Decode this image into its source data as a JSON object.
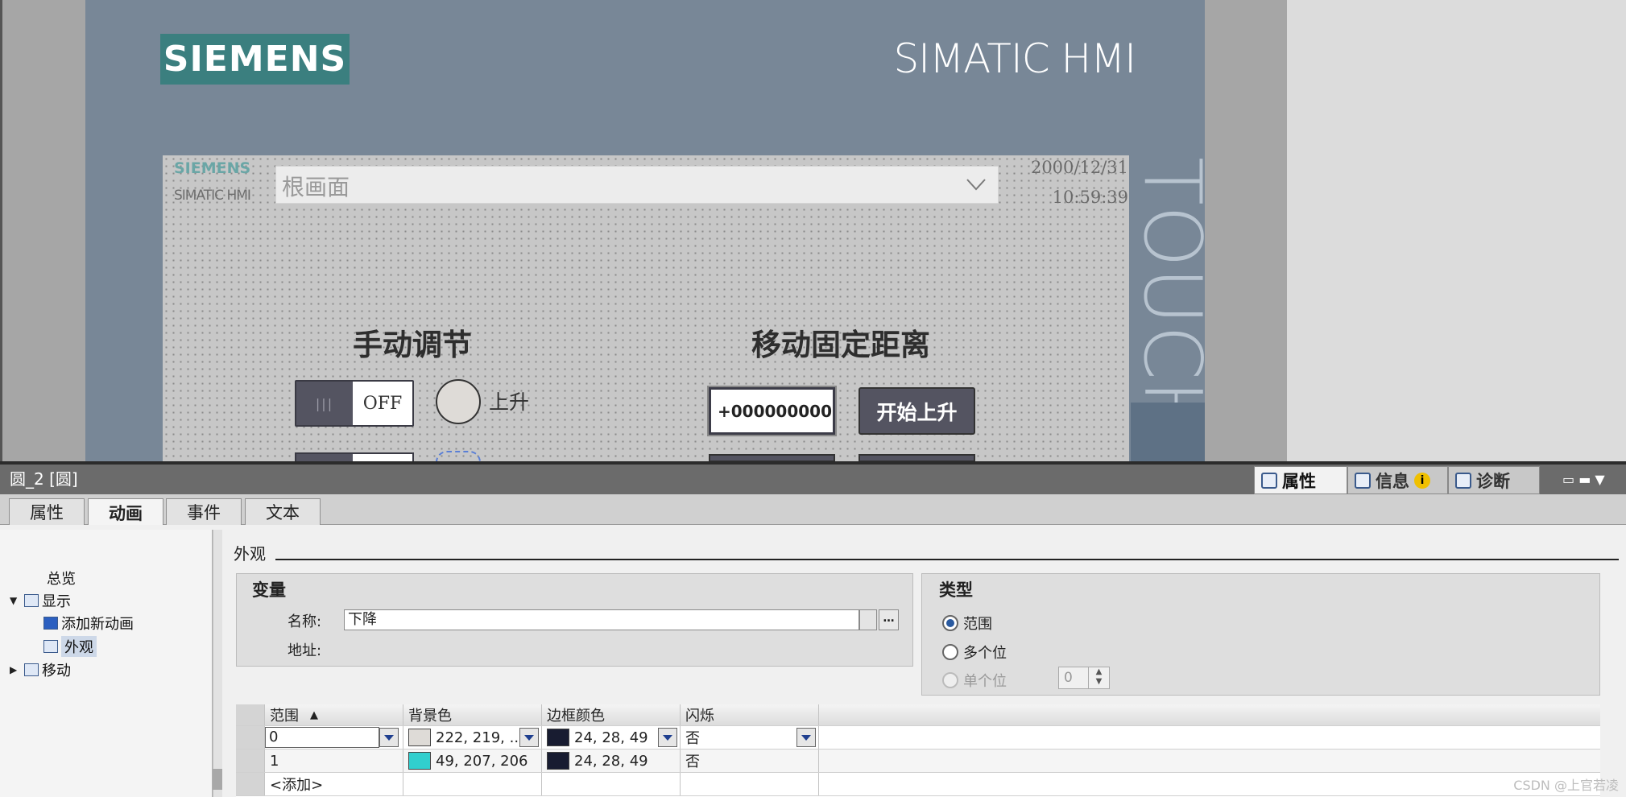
{
  "hmi": {
    "brand_logo": "SIEMENS",
    "product_title": "SIMATIC HMI",
    "side_label": "TOUCH",
    "screen": {
      "logo": "SIEMENS",
      "subtitle": "SIMATIC HMI",
      "root_screen_label": "根画面",
      "date": "2000/12/31",
      "time": "10:59:39",
      "manual_title": "手动调节",
      "move_title": "移动固定距离",
      "toggle_knob": "|||",
      "toggle_state": "OFF",
      "up_label": "上升",
      "distance_value": "+000000000.",
      "start_up_button": "开始上升"
    }
  },
  "inspector": {
    "object_title": "圆_2 [圆]",
    "top_tabs": [
      {
        "label": "属性",
        "icon": "properties-icon",
        "active": true
      },
      {
        "label": "信息",
        "icon": "info-icon",
        "active": false
      },
      {
        "label": "诊断",
        "icon": "diagnostics-icon",
        "active": false
      }
    ],
    "info_badge": "i",
    "window_controls": "▭ ▬ ▼",
    "sub_tabs": [
      "属性",
      "动画",
      "事件",
      "文本"
    ],
    "active_sub_tab": "动画",
    "nav": {
      "overview": "总览",
      "display": "显示",
      "add_new_animation": "添加新动画",
      "appearance": "外观",
      "movement": "移动"
    },
    "section_title": "外观",
    "variable": {
      "group_title": "变量",
      "name_label": "名称:",
      "name_value": "下降",
      "address_label": "地址:"
    },
    "type": {
      "group_title": "类型",
      "options": [
        "范围",
        "多个位",
        "单个位"
      ],
      "selected": "范围",
      "single_bit_value": "0"
    },
    "table": {
      "headers": [
        "范围",
        "背景色",
        "边框颜色",
        "闪烁"
      ],
      "sort_indicator": "▲",
      "rows": [
        {
          "range": "0",
          "bg_color_text": "222, 219, ...",
          "bg_color": "#dedbd7",
          "border_color_text": "24, 28, 49",
          "border_color": "#181c31",
          "blink": "否"
        },
        {
          "range": "1",
          "bg_color_text": "49, 207, 206",
          "bg_color": "#31cfce",
          "border_color_text": "24, 28, 49",
          "border_color": "#181c31",
          "blink": "否"
        }
      ],
      "add_row": "<添加>"
    },
    "watermark": "CSDN @上官若凌"
  }
}
